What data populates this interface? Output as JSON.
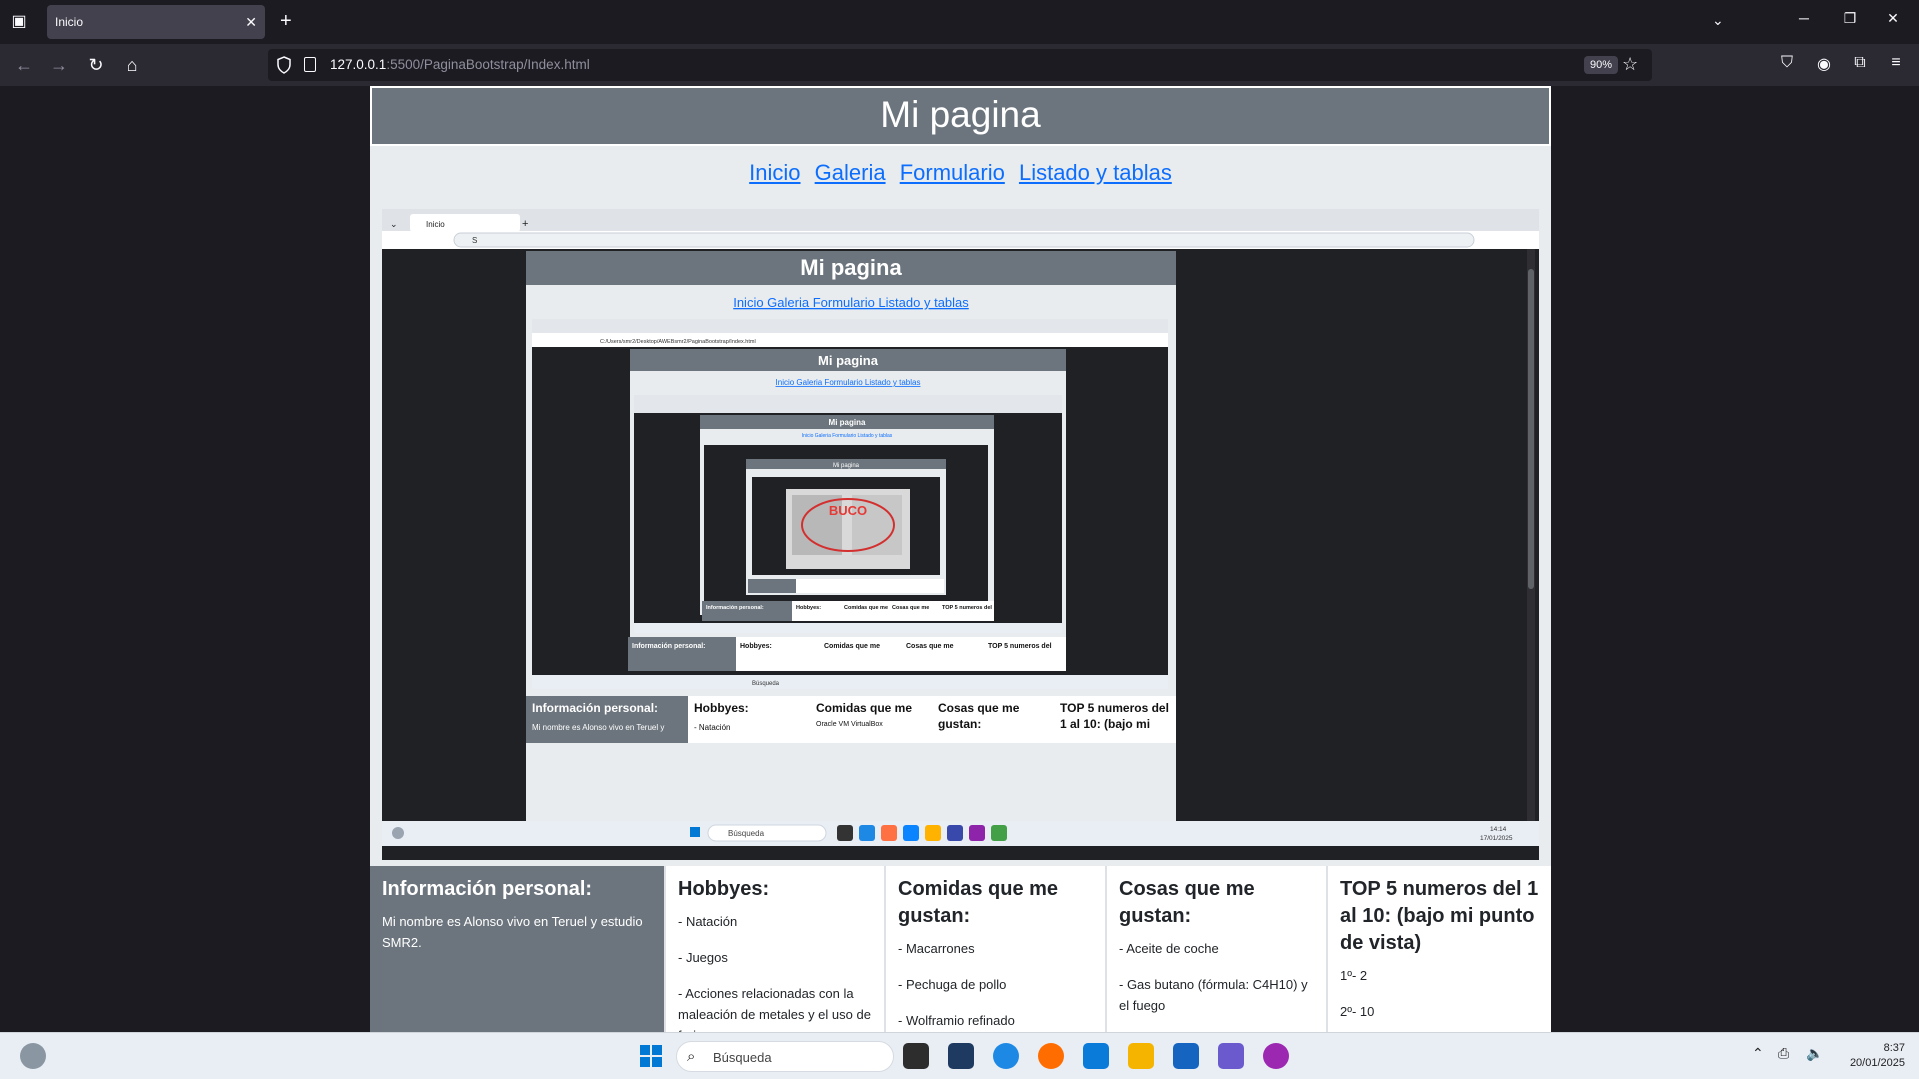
{
  "browser": {
    "tab_title": "Inicio",
    "url_host": "127.0.0.1",
    "url_path": ":5500/PaginaBootstrap/Index.html",
    "zoom": "90%"
  },
  "page": {
    "title": "Mi pagina",
    "nav": [
      "Inicio",
      "Galeria",
      "Formulario",
      "Listado y tablas"
    ],
    "columns": {
      "info": {
        "title": "Información personal:",
        "text": "Mi nombre es Alonso vivo en Teruel y estudio SMR2."
      },
      "hobbies": {
        "title": "Hobbyes:",
        "items": [
          "- Natación",
          "- Juegos",
          "- Acciones relacionadas con la maleación de metales y el uso de forjas"
        ]
      },
      "comidas": {
        "title": "Comidas que me gustan:",
        "items": [
          "- Macarrones",
          "- Pechuga de pollo",
          "- Wolframio refinado"
        ]
      },
      "cosas": {
        "title": "Cosas que me gustan:",
        "items": [
          "- Aceite de coche",
          "- Gas butano (fórmula: C4H10) y el fuego"
        ]
      },
      "top": {
        "title": "TOP 5 numeros del 1 al 10: (bajo mi punto de vista)",
        "items": [
          "1º- 2",
          "2º- 10"
        ]
      }
    }
  },
  "nested_screenshot": {
    "inner_url": "C:/Users/smr2/Desktop/AWEBsmr2/PaginaBootstrap/Index.html",
    "inner_title": "Mi pagina",
    "inner_search_text": "Búsqueda",
    "inner_clock_time": "14:14",
    "inner_clock_date": "17/01/2025",
    "inner_first_item": "Oracle VM VirtualBox",
    "center_text": "BUCO"
  },
  "taskbar": {
    "search_placeholder": "Búsqueda",
    "time": "8:37",
    "date": "20/01/2025"
  }
}
